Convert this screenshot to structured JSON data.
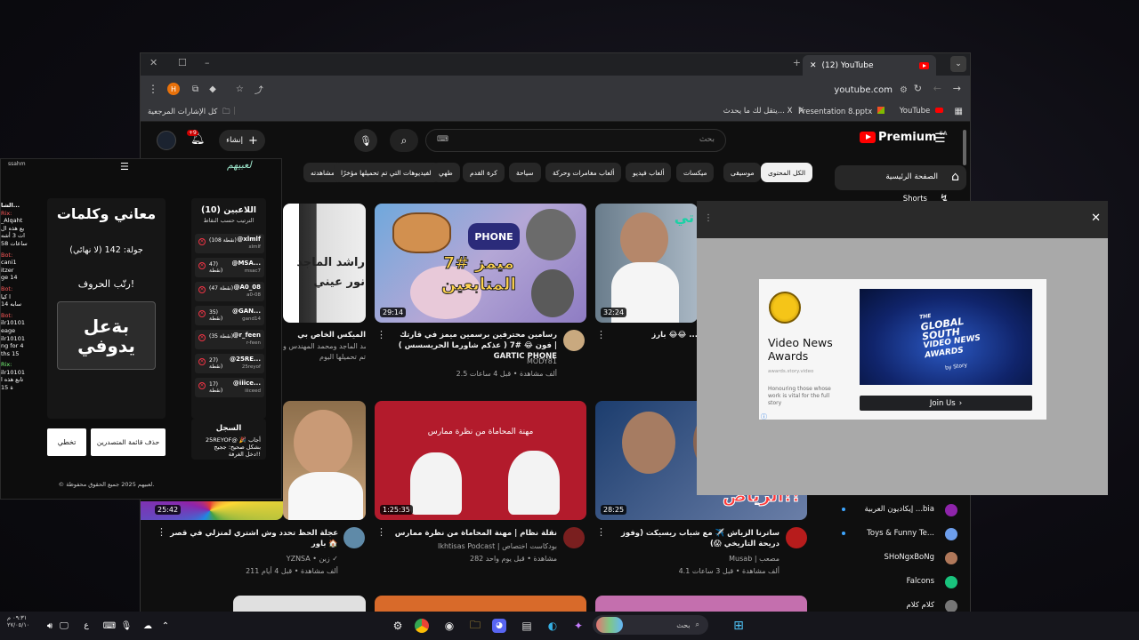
{
  "browser": {
    "tab_title": "(12) YouTube",
    "address": "youtube.com",
    "bookmarks": [
      {
        "label": "YouTube",
        "icon": "youtube-icon"
      },
      {
        "label": "Presentation 8.pptx",
        "icon": "office-icon"
      },
      {
        "label": "يتقل لك ما يحدث... X",
        "icon": "x-icon"
      },
      {
        "label": "كل الإشارات المرجعية",
        "icon": "folder-icon"
      }
    ],
    "profile_initial": "H"
  },
  "youtube": {
    "logo": "Premium",
    "logo_sup": "SA",
    "search_placeholder": "بحث",
    "create_label": "إنشاء",
    "notif_count": "+9",
    "chips": [
      "الكل المحتوى",
      "موسيقى",
      "ميكسات",
      "ألعاب فيديو",
      "ألعاب مغامرات وحركة",
      "سياحة",
      "كرة القدم",
      "طهي",
      "الفيديوهات التي تم تحميلها مؤخرًا",
      "تمت مشاهدته"
    ],
    "sidebar": {
      "home": "الصفحة الرئيسية",
      "shorts": "Shorts",
      "subs": [
        {
          "name": "إيكاديون العربية ...bia"
        },
        {
          "name": "Toys & Funny Te..."
        },
        {
          "name": "SHoNgxBoNg"
        },
        {
          "name": "Falcons"
        },
        {
          "name": "كلام كلام"
        }
      ]
    },
    "videos": [
      {
        "title": "رسامين محترفين برسمين ميمز في قارتك فون 😂 #7 ( عذكم شاورما الحريسسس ) | GARTIC PHONE",
        "channel": "MODY81",
        "meta": "2.5 ألف مشاهدة • قبل 4 ساعات",
        "duration": "29:14",
        "thumb_text": "ميمز #7 المتابعين",
        "thumb_sub": "PHONE"
      },
      {
        "title": "بارز 😂😂 ...",
        "channel": "",
        "meta": "",
        "duration": "32:24",
        "thumb_text": "تي"
      },
      {
        "title": "الميكس الخاص بي",
        "channel": "راشد الماجد ومحمد المهندس و...",
        "meta": "تم تحميلها اليوم",
        "duration": "",
        "thumb_text": "راشد الماجد نور عيني"
      },
      {
        "title": "ساترنا الزياش ✈️ مع شباب ريسيكت (وفوز دريحة التاريخي 😱)",
        "channel": "Musab | مصعب",
        "meta": "4.1 ألف مشاهدة • قبل 3 ساعات",
        "duration": "28:25",
        "thumb_text": "الرياض!!"
      },
      {
        "title": "نقلة نظام | مهنة المحاماة من نظرة ممارس",
        "channel": "Ikhtisas Podcast | بودكاست اختصاص",
        "meta": "282 مشاهدة • قبل يوم واحد",
        "duration": "1:25:35",
        "thumb_text": "مهنة المحاماة من نظرة ممارس"
      },
      {
        "title": "عجلة الحظ تحدد وش اشتري لمنزلي في قصر باور 🏠",
        "channel": "YZNSA • زين ✓",
        "meta": "211 ألف مشاهدة • قبل 4 أيام",
        "duration": "25:42",
        "thumb_text": ""
      }
    ]
  },
  "game": {
    "brand": "لعبيهم",
    "username": "ssahm",
    "players_title": "اللاعبين (10)",
    "players_sub": "الترتيب حسب النقاط",
    "players": [
      {
        "handle": "@xlmlf",
        "sub": "xlmlf",
        "points": "(108 نقطة)"
      },
      {
        "handle": "@MSA...",
        "sub": "msac7",
        "points": "47) نقطة)"
      },
      {
        "handle": "@A0_08",
        "sub": "a0-08",
        "points": "(47 نقطة)"
      },
      {
        "handle": "@GAN...",
        "sub": "gand14",
        "points": "35) نقطة)"
      },
      {
        "handle": "@r_feen",
        "sub": "r-feen",
        "points": "(35 نقطة)"
      },
      {
        "handle": "@25RE...",
        "sub": "25reyof",
        "points": "27) نقطة)"
      },
      {
        "handle": "@iiice...",
        "sub": "iiiceed",
        "points": "17) نقطة)"
      }
    ],
    "history_title": "السجل",
    "history_lines": [
      "25REYOF@ 🎉 أجاب",
      "بشكل صحيح: ججيج",
      "دخل الغرفة!!"
    ],
    "mode_title": "معاني وكلمات",
    "round": "جولة: 142 (لا نهائي)",
    "instruction": "رتّب الحروف!",
    "scramble": "بةعل يدوفي",
    "btn_clear": "حذف قائمة المتصدرين",
    "btn_skip": "تخطي",
    "footer": "© لعبيهم 2025 جميع الحقوق محفوظة.",
    "chat": [
      {
        "name": "الشا...",
        "color": "#ffffff"
      },
      {
        "name": "Rix:",
        "color": "#ff5a5a"
      },
      {
        "name": "_Alqaht",
        "color": "#ffffff"
      },
      {
        "name": "يع هذه ال",
        "color": "#ffffff"
      },
      {
        "name": "ات 3 أشه",
        "color": "#ffffff"
      },
      {
        "name": "ساعات 58",
        "color": "#ffffff"
      },
      {
        "name": "Bot:",
        "color": "#ff5a5a"
      },
      {
        "name": "cani1",
        "color": "#ffffff"
      },
      {
        "name": "itzer",
        "color": "#ffffff"
      },
      {
        "name": "ge 14",
        "color": "#ffffff"
      },
      {
        "name": "Bot:",
        "color": "#ff5a5a"
      },
      {
        "name": "ا کیا",
        "color": "#ffffff"
      },
      {
        "name": "سابه 14",
        "color": "#ffffff"
      },
      {
        "name": "Bot:",
        "color": "#ff5a5a"
      },
      {
        "name": "ilr10101",
        "color": "#ffffff"
      },
      {
        "name": "eage",
        "color": "#ffffff"
      },
      {
        "name": "ilr10101",
        "color": "#ffffff"
      },
      {
        "name": "ng for 4",
        "color": "#ffffff"
      },
      {
        "name": "ths 15",
        "color": "#ffffff"
      },
      {
        "name": "Rix:",
        "color": "#ff5a5a"
      },
      {
        "name": "ilr10101",
        "color": "#ffffff"
      },
      {
        "name": "تابع هذه ا",
        "color": "#ffffff"
      },
      {
        "name": "ة 15",
        "color": "#ffffff"
      }
    ]
  },
  "ad": {
    "brand": "Video News Awards",
    "domain": "awards.story.video",
    "desc": "Honouring those whose work is vital for the full story",
    "image_lines": [
      "THE",
      "GLOBAL",
      "SOUTH",
      "VIDEO NEWS",
      "AWARDS"
    ],
    "image_sub": "by Story",
    "cta": "Join Us",
    "close": "✕"
  },
  "taskbar": {
    "time": "٠٩:٣١ م",
    "date": "٢٧/٠٥/١٠",
    "lang": "ع",
    "search_placeholder": "بحث"
  },
  "colors": {
    "yt_red": "#ff0000",
    "accent": "#3ea6ff"
  }
}
